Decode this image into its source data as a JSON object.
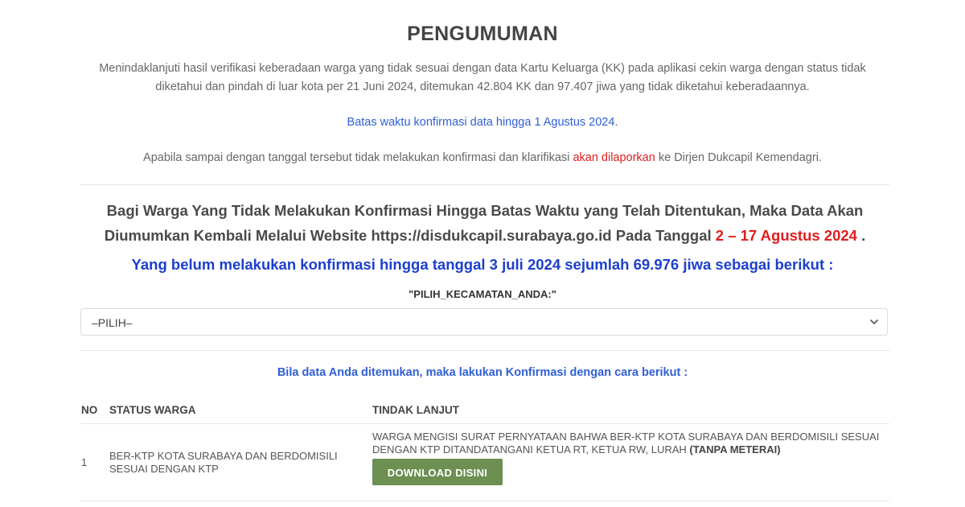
{
  "title": "PENGUMUMAN",
  "intro": "Menindaklanjuti hasil verifikasi keberadaan warga yang tidak sesuai dengan data Kartu Keluarga (KK) pada aplikasi cekin warga dengan status tidak diketahui dan pindah di luar kota per 21 Juni 2024, ditemukan 42.804 KK dan 97.407 jiwa yang tidak diketahui keberadaannya.",
  "deadline": {
    "text": "Batas waktu konfirmasi data hingga 1 Agustus 2024",
    "end": "."
  },
  "warning": {
    "before": "Apabila sampai dengan tanggal tersebut tidak melakukan konfirmasi dan klarifikasi ",
    "highlight": "akan dilaporkan",
    "after": " ke Dirjen Dukcapil Kemendagri."
  },
  "notice": {
    "text": "Bagi Warga Yang Tidak Melakukan Konfirmasi Hingga Batas Waktu yang Telah Ditentukan, Maka Data Akan Diumumkan Kembali Melalui Website https://disdukcapil.surabaya.go.id Pada Tanggal ",
    "date": "2 – 17 Agustus 2024",
    "end": " ."
  },
  "status_line": "Yang belum melakukan konfirmasi hingga tanggal 3 juli 2024 sejumlah 69.976 jiwa sebagai berikut :",
  "select": {
    "label": "\"PILIH_KECAMATAN_ANDA:\"",
    "value": "–PILIH–",
    "icon": "chevron-down-icon"
  },
  "found_line": "Bila data Anda ditemukan, maka lakukan Konfirmasi dengan cara berikut :",
  "table": {
    "headers": [
      "NO",
      "STATUS WARGA",
      "TINDAK LANJUT"
    ],
    "rows": [
      {
        "no": "1",
        "status": "BER-KTP KOTA SURABAYA DAN BERDOMISILI SESUAI DENGAN KTP",
        "action": "WARGA MENGISI SURAT PERNYATAAN BAHWA BER-KTP KOTA SURABAYA DAN BERDOMISILI SESUAI DENGAN KTP DITANDATANGANI KETUA RT, KETUA RW, LURAH ",
        "action_bold": "(TANPA METERAI)",
        "button": "DOWNLOAD DISINI"
      }
    ]
  },
  "colors": {
    "blue": "#2f5fd6",
    "red": "#e11d1d",
    "button_green": "#6d8f52"
  }
}
